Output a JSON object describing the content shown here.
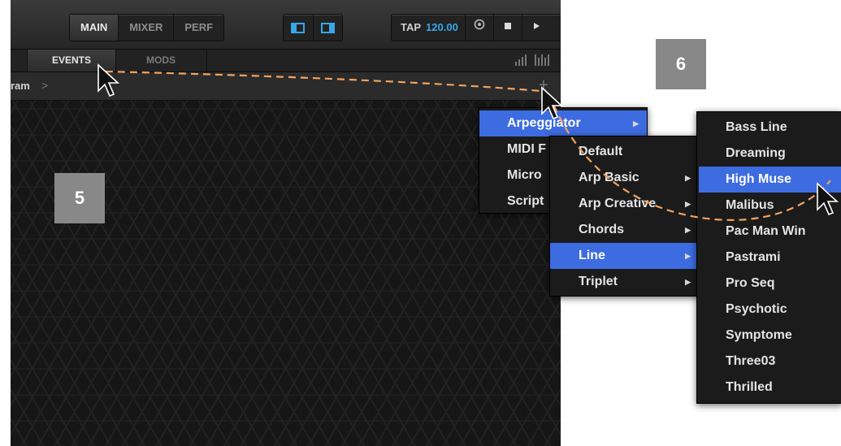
{
  "header": {
    "view_tabs": [
      "MAIN",
      "MIXER",
      "PERF"
    ],
    "active_view": "MAIN",
    "transport": {
      "tap_label": "TAP",
      "tempo": "120.00"
    }
  },
  "tabs": {
    "events_label": "EVENTS",
    "mods_label": "MODS"
  },
  "breadcrumb": {
    "text": "ram",
    "chevron": ">",
    "add_symbol": "+"
  },
  "step_badges": {
    "left": "5",
    "right": "6"
  },
  "menu_main": {
    "items": [
      "Arpeggiator",
      "MIDI F",
      "Micro",
      "Script"
    ],
    "highlighted": "Arpeggiator"
  },
  "menu_arpeggiator": {
    "items": [
      "Default",
      "Arp Basic",
      "Arp Creative",
      "Chords",
      "Line",
      "Triplet"
    ],
    "highlighted": "Line"
  },
  "menu_line": {
    "items": [
      "Bass Line",
      "Dreaming",
      "High Muse",
      "Malibus",
      "Pac Man Win",
      "Pastrami",
      "Pro Seq",
      "Psychotic",
      "Symptome",
      "Three03",
      "Thrilled"
    ],
    "highlighted": "High Muse"
  },
  "colors": {
    "accent_blue": "#37a7e8",
    "menu_highlight": "#3d6ce0",
    "dashed_path": "#f2a35f",
    "step_badge": "#888888"
  },
  "icons": [
    "layout-left-icon",
    "layout-right-icon",
    "sync-icon",
    "stop-icon",
    "play-icon",
    "meter-icon",
    "piano-icon",
    "mouse-cursor-icon"
  ]
}
